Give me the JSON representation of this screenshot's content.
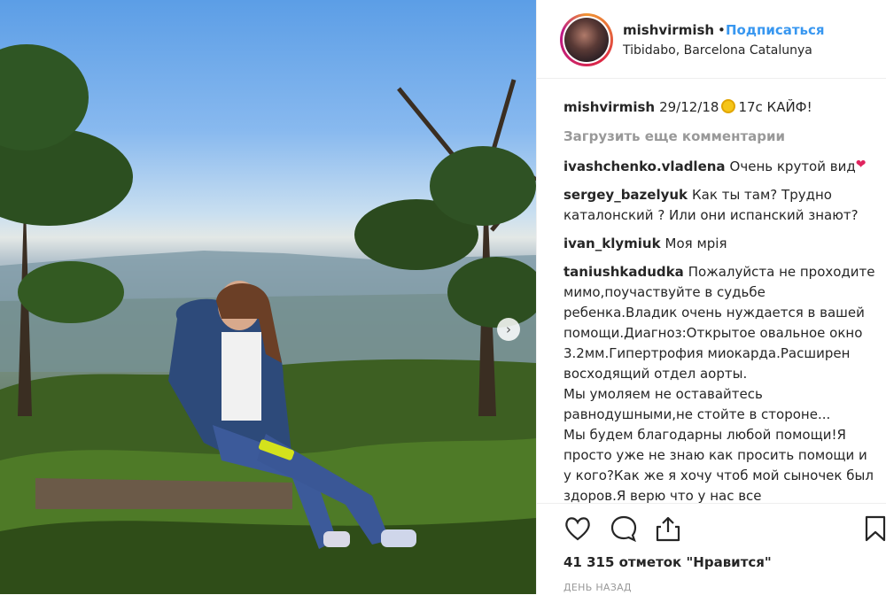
{
  "post": {
    "username": "mishvirmish",
    "follow_label": "Подписаться",
    "dot": "•",
    "location": "Tibidabo, Barcelona Catalunya"
  },
  "caption": {
    "username": "mishvirmish",
    "text_before": "29/12/18",
    "text_after": "17с КАЙФ!"
  },
  "load_more": "Загрузить еще комментарии",
  "comments": [
    {
      "user": "ivashchenko.vladlena",
      "text": "Очень крутой вид"
    },
    {
      "user": "sergey_bazelyuk",
      "text": "Как ты там? Трудно каталонский ? Или они испанский знают?"
    },
    {
      "user": "ivan_klymiuk",
      "text": "Моя мрія"
    },
    {
      "user": "taniushkadudka",
      "text": "Пожалуйста не проходите мимо,поучаствуйте в судьбе ребенка.Владик очень нуждается в вашей помощи.Диагноз:Открытое овальное окно 3.2мм.Гипертрофия миокарда.Расширен восходящий отдел аорты."
    },
    {
      "user": "",
      "text": "Мы умоляем не оставайтесь равнодушными,не стойте в стороне..."
    },
    {
      "user": "",
      "text": "Мы будем благодарны любой помощи!Я просто уже не знаю как просить помощи и у кого?Как же я хочу чтоб мой сыночек был здоров.Я верю что у нас все"
    }
  ],
  "likes": "41 315 отметок \"Нравится\"",
  "time": "ДЕНЬ НАЗАД",
  "icons": {
    "like": "heart-icon",
    "comment": "comment-icon",
    "share": "share-icon",
    "save": "bookmark-icon",
    "next": "chevron-right-icon"
  },
  "colors": {
    "link": "#3897f0",
    "text": "#262626",
    "muted": "#999999"
  }
}
